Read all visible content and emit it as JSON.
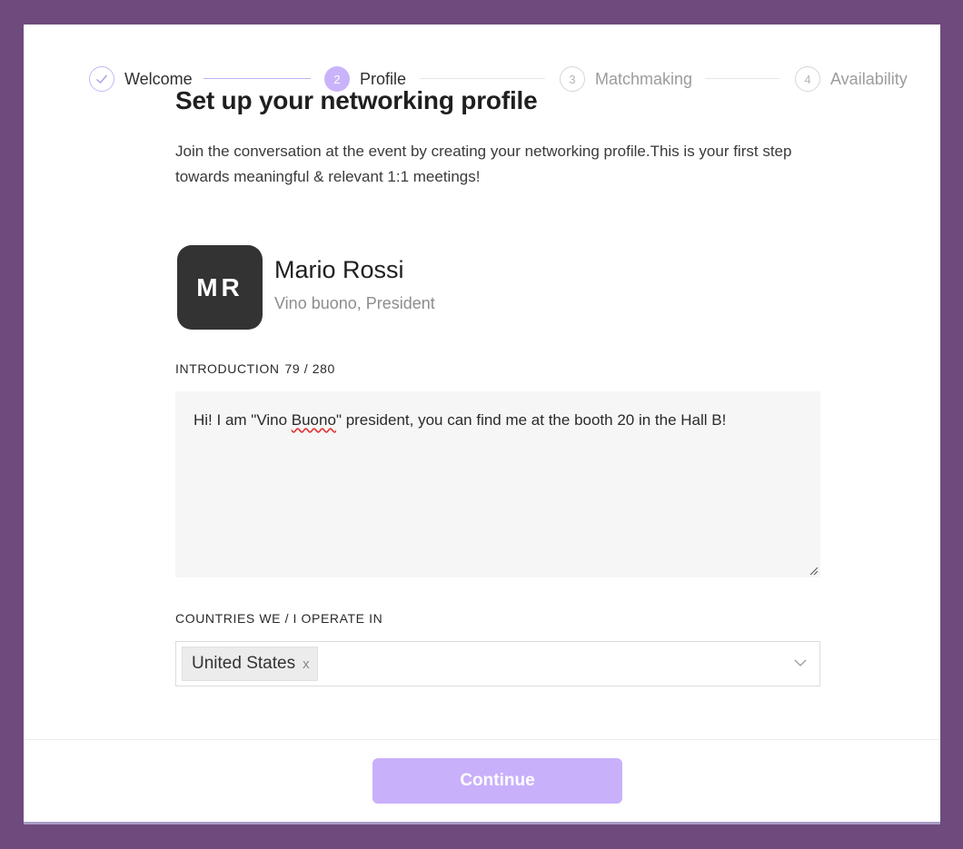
{
  "stepper": {
    "steps": [
      {
        "marker": "✓",
        "label": "Welcome",
        "state": "done"
      },
      {
        "marker": "2",
        "label": "Profile",
        "state": "active"
      },
      {
        "marker": "3",
        "label": "Matchmaking",
        "state": "todo"
      },
      {
        "marker": "4",
        "label": "Availability",
        "state": "todo"
      }
    ]
  },
  "page": {
    "title": "Set up your networking profile",
    "intro": "Join the conversation at the event by creating your networking profile.This is your first step towards meaningful & relevant 1:1 meetings!"
  },
  "profile": {
    "initials": "MR",
    "name": "Mario Rossi",
    "subtitle": "Vino buono, President"
  },
  "introduction": {
    "label": "INTRODUCTION",
    "count": "79 / 280",
    "text_before": "Hi! I am \"Vino ",
    "text_flagged": "Buono",
    "text_after": "\" president, you can find me at the booth 20 in the Hall B!"
  },
  "countries": {
    "label": "COUNTRIES WE / I OPERATE IN",
    "selected": "United States",
    "remove_glyph": "x"
  },
  "footer": {
    "continue_label": "Continue"
  },
  "colors": {
    "frame": "#6e4a7d",
    "accent": "#c9b4fb",
    "avatar_bg": "#333333"
  }
}
